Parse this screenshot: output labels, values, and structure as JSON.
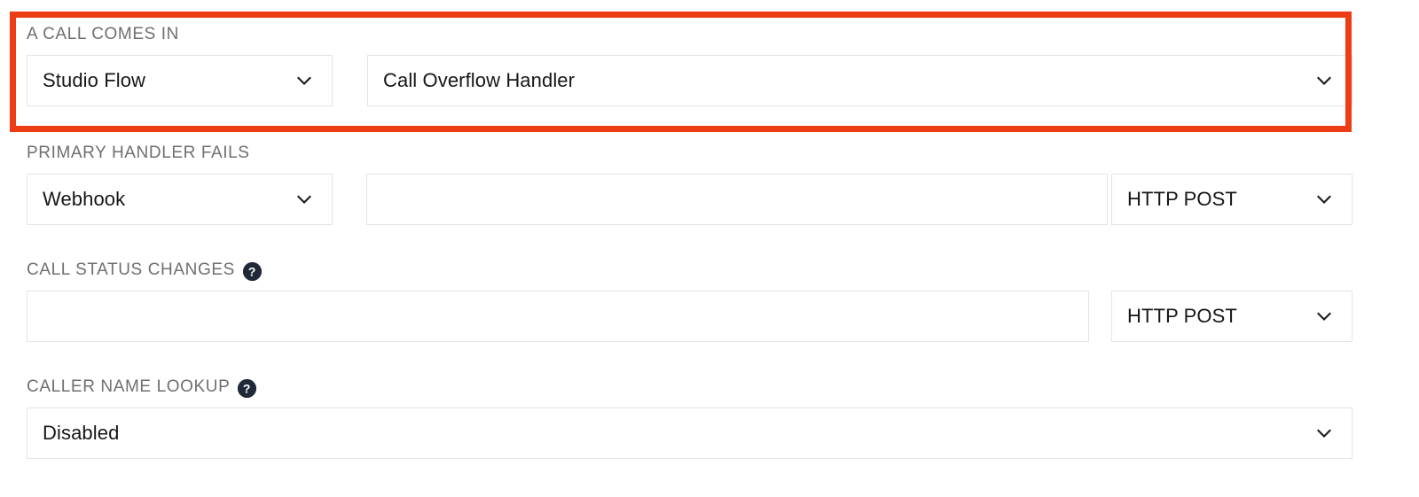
{
  "sections": [
    {
      "id": "a-call-comes-in",
      "label": "A CALL COMES IN",
      "has_help": false,
      "handler_type": "Studio Flow",
      "flow_name": "Call Overflow Handler"
    },
    {
      "id": "primary-handler-fails",
      "label": "PRIMARY HANDLER FAILS",
      "has_help": false,
      "handler_type": "Webhook",
      "url_value": "",
      "url_placeholder": "",
      "method": "HTTP POST"
    },
    {
      "id": "call-status-changes",
      "label": "CALL STATUS CHANGES",
      "has_help": true,
      "url_value": "",
      "url_placeholder": "",
      "method": "HTTP POST"
    },
    {
      "id": "caller-name-lookup",
      "label": "CALLER NAME LOOKUP",
      "has_help": true,
      "value": "Disabled"
    }
  ],
  "icons": {
    "help": "help-circle-icon",
    "chevron": "chevron-down-icon"
  },
  "annotation": {
    "type": "highlight-rectangle",
    "color": "#ec3d16"
  },
  "colors": {
    "highlight": "#ec3d16",
    "label_text": "#6f6f6f",
    "value_text": "#161616",
    "field_border": "#e3e4e6",
    "help_icon_bg": "#1f2937",
    "background": "#ffffff"
  }
}
